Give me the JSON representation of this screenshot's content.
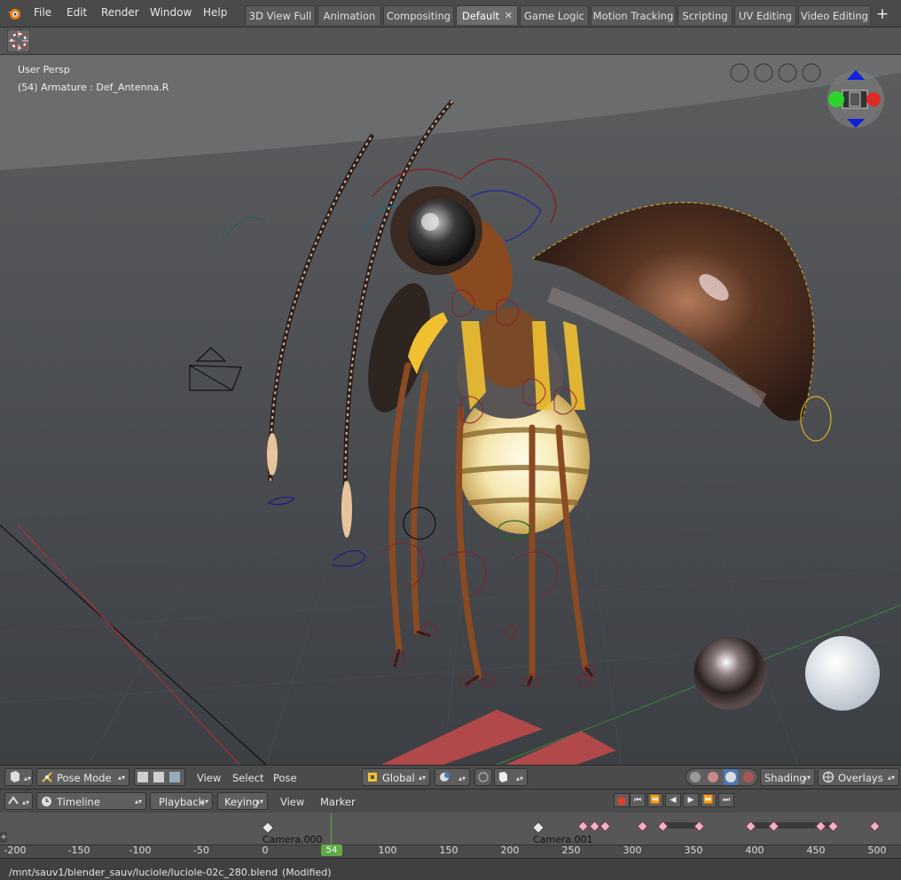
{
  "menubar": {
    "logo_icon": "blender-logo-icon",
    "items": [
      "File",
      "Edit",
      "Render",
      "Window",
      "Help"
    ]
  },
  "workspace_tabs": [
    {
      "label": "3D View Full",
      "active": false
    },
    {
      "label": "Animation",
      "active": false
    },
    {
      "label": "Compositing",
      "active": false
    },
    {
      "label": "Default",
      "active": true
    },
    {
      "label": "Game Logic",
      "active": false
    },
    {
      "label": "Motion Tracking",
      "active": false
    },
    {
      "label": "Scripting",
      "active": false
    },
    {
      "label": "UV Editing",
      "active": false
    },
    {
      "label": "Video Editing",
      "active": false
    }
  ],
  "tab_close_glyph": "✕",
  "tab_add_glyph": "+",
  "viewport": {
    "view_name": "User Persp",
    "object_info": "(54) Armature : Def_Antenna.R"
  },
  "header3d": {
    "mode": "Pose Mode",
    "menus": [
      "View",
      "Select",
      "Pose"
    ],
    "orientation": "Global",
    "shading_label": "Shading",
    "overlays_label": "Overlays"
  },
  "timeline_header": {
    "editor": "Timeline",
    "playback": "Playback",
    "keying": "Keying",
    "menus": [
      "View",
      "Marker"
    ]
  },
  "timeline": {
    "current_frame": "54",
    "markers": [
      "Camera.000",
      "Camera.001"
    ],
    "ruler_ticks": [
      "-200",
      "-150",
      "-100",
      "-50",
      "0",
      "50",
      "100",
      "150",
      "200",
      "250",
      "300",
      "350",
      "400",
      "450",
      "500"
    ]
  },
  "status": {
    "filepath": "/mnt/sauv1/blender_sauv/luciole/luciole-02c_280.blend",
    "state": "(Modified)"
  },
  "colors": {
    "accent_current_frame": "#5faa45",
    "keyframe": "#f0b2c6",
    "record": "#e0402a"
  }
}
